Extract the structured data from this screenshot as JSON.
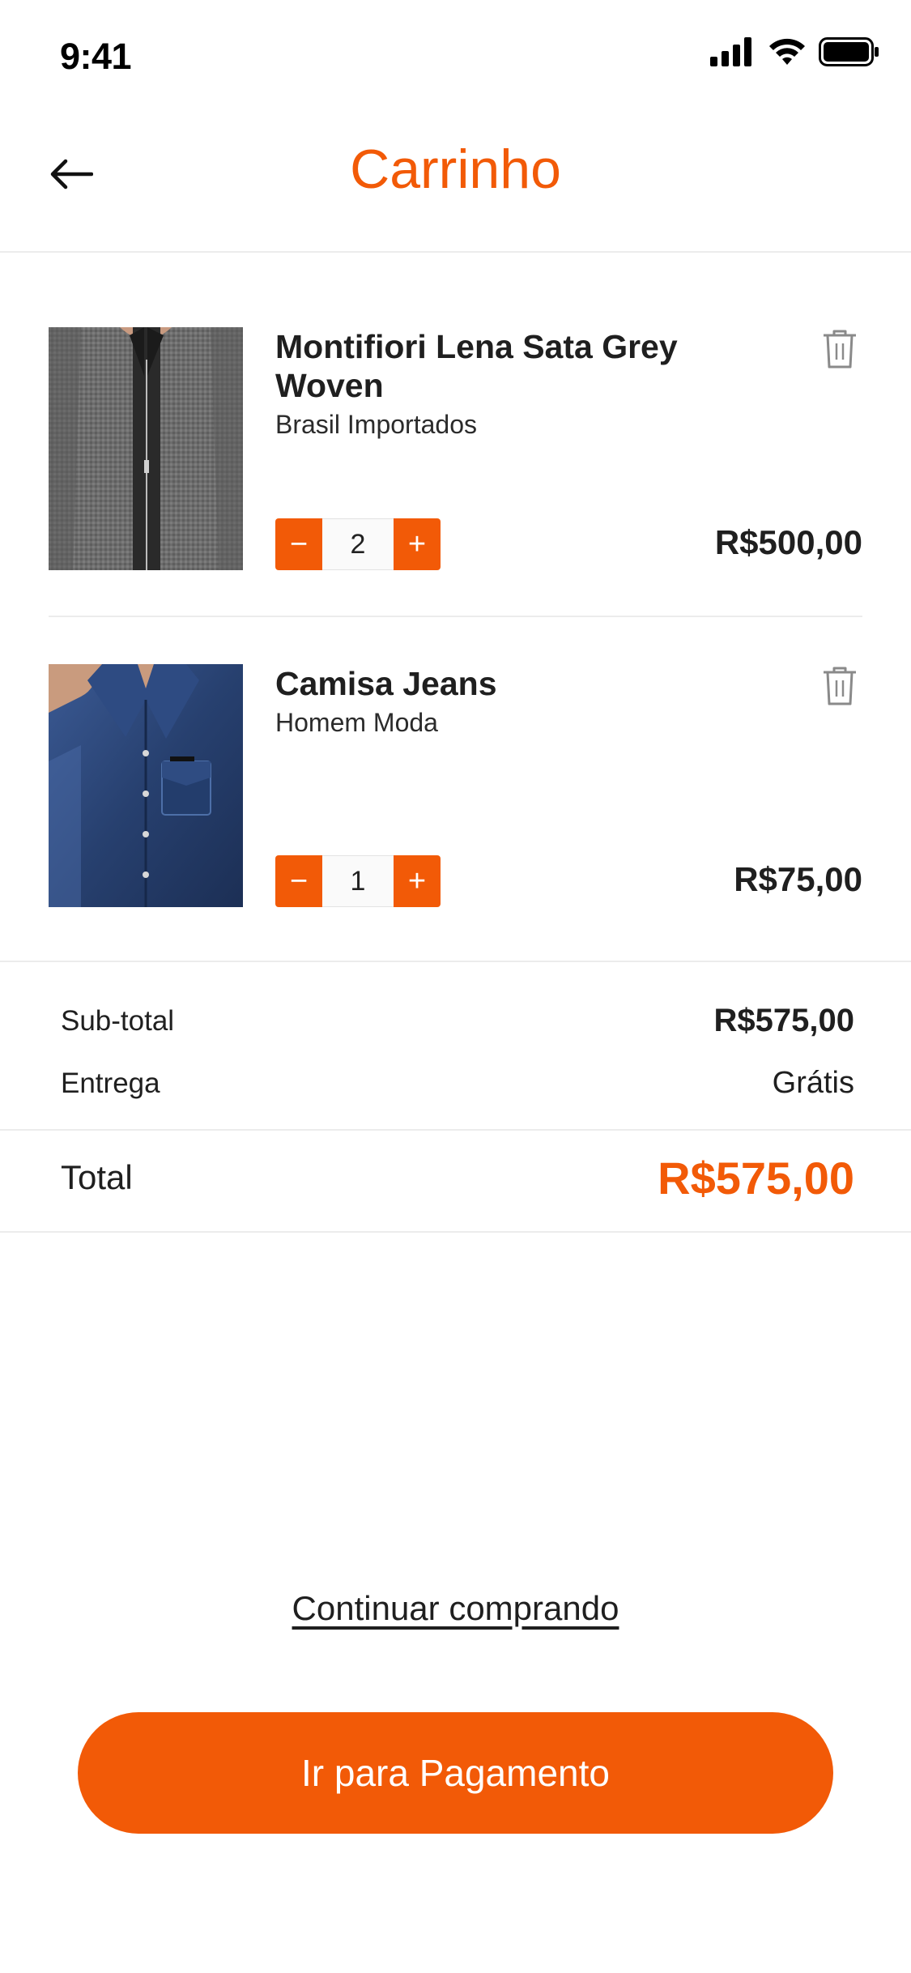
{
  "status_bar": {
    "time": "9:41"
  },
  "header": {
    "title": "Carrinho",
    "back_icon": "arrow-left-icon"
  },
  "cart": {
    "items": [
      {
        "name": "Montifiori Lena Sata Grey Woven",
        "brand": "Brasil Importados",
        "quantity": "2",
        "price": "R$500,00",
        "decrease_label": "−",
        "increase_label": "+",
        "image_icon": "grey-knit-jacket-photo"
      },
      {
        "name": "Camisa Jeans",
        "brand": "Homem Moda",
        "quantity": "1",
        "price": "R$75,00",
        "decrease_label": "−",
        "increase_label": "+",
        "image_icon": "denim-shirt-photo"
      }
    ]
  },
  "summary": {
    "subtotal_label": "Sub-total",
    "subtotal_value": "R$575,00",
    "delivery_label": "Entrega",
    "delivery_value": "Grátis",
    "total_label": "Total",
    "total_value": "R$575,00"
  },
  "actions": {
    "continue_label": "Continuar comprando",
    "pay_label": "Ir para Pagamento"
  },
  "colors": {
    "accent": "#f25a07",
    "text": "#1f1f1f",
    "divider": "#ececec"
  }
}
